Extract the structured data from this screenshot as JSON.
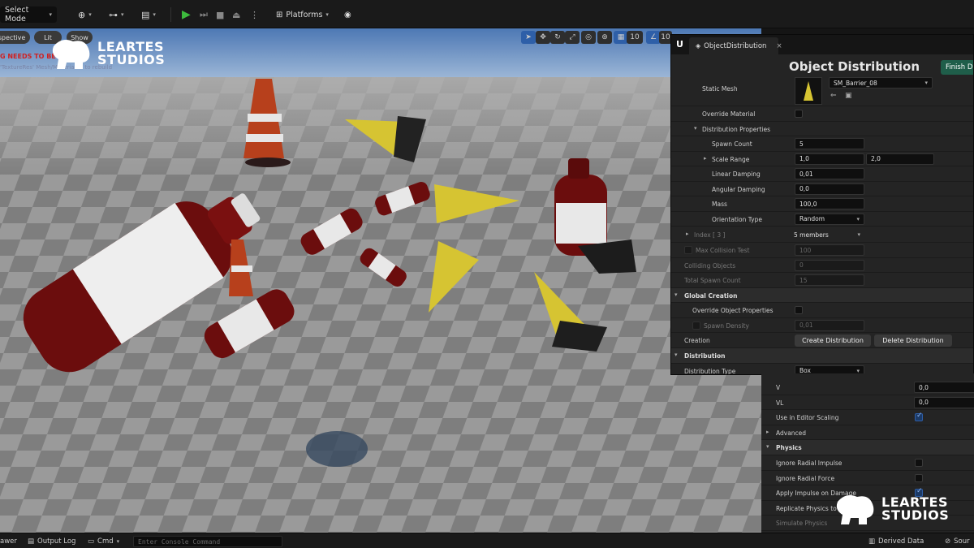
{
  "toolbar": {
    "select_mode": "Select Mode",
    "platforms": "Platforms"
  },
  "viewport": {
    "perspective": "spective",
    "lit": "Lit",
    "show": "Show",
    "grid_snap": "10",
    "rotation_snap": "10",
    "warning": "G NEEDS TO BE REBUILT",
    "warning_sub": "'TextureRes' Mesh/Material ... to rebuild"
  },
  "logo": {
    "line1": "LEARTES",
    "line2": "STUDIOS"
  },
  "object_distribution": {
    "tab_label": "ObjectDistribution",
    "title": "Object Distribution",
    "finish_button": "Finish Distribution",
    "static_mesh_label": "Static Mesh",
    "static_mesh_value": "SM_Barrier_08",
    "override_material_label": "Override Material",
    "distribution_properties_label": "Distribution Properties",
    "spawn_count_label": "Spawn Count",
    "spawn_count_value": "5",
    "scale_range_label": "Scale Range",
    "scale_min": "1,0",
    "scale_max": "2,0",
    "linear_damping_label": "Linear Damping",
    "linear_damping_value": "0,01",
    "angular_damping_label": "Angular Damping",
    "angular_damping_value": "0,0",
    "mass_label": "Mass",
    "mass_value": "100,0",
    "orientation_type_label": "Orientation Type",
    "orientation_type_value": "Random",
    "index_label": "Index [ 3 ]",
    "index_value": "5 members",
    "max_collision_label": "Max Collision Test",
    "max_collision_value": "100",
    "colliding_objects_label": "Colliding Objects",
    "colliding_objects_value": "0",
    "total_spawn_label": "Total Spawn Count",
    "total_spawn_value": "15",
    "global_creation_label": "Global Creation",
    "override_object_props_label": "Override Object Properties",
    "spawn_density_label": "Spawn Density",
    "spawn_density_value": "0,01",
    "creation_label": "Creation",
    "create_button": "Create Distribution",
    "delete_button": "Delete Distribution",
    "distribution_section_label": "Distribution",
    "distribution_type_label": "Distribution Type",
    "distribution_type_value": "Box"
  },
  "details": {
    "v_label": "V",
    "v_value": "0,0",
    "vl_label": "VL",
    "vl_value": "0,0",
    "editor_scaling_label": "Use in Editor Scaling",
    "advanced_label": "Advanced",
    "physics_label": "Physics",
    "ignore_radial_impulse_label": "Ignore Radial Impulse",
    "ignore_radial_force_label": "Ignore Radial Force",
    "apply_impulse_label": "Apply Impulse on Damage",
    "replicate_physics_label": "Replicate Physics to A",
    "simulate_physics_label": "Simulate Physics"
  },
  "statusbar": {
    "drawer": "awer",
    "output_log": "Output Log",
    "cmd": "Cmd",
    "console_placeholder": "Enter Console Command",
    "derived_data": "Derived Data",
    "source": "Sour"
  },
  "colors": {
    "accent_green": "#1f5e4a",
    "play_green": "#3dbb3d",
    "warning_red": "#d02020"
  }
}
